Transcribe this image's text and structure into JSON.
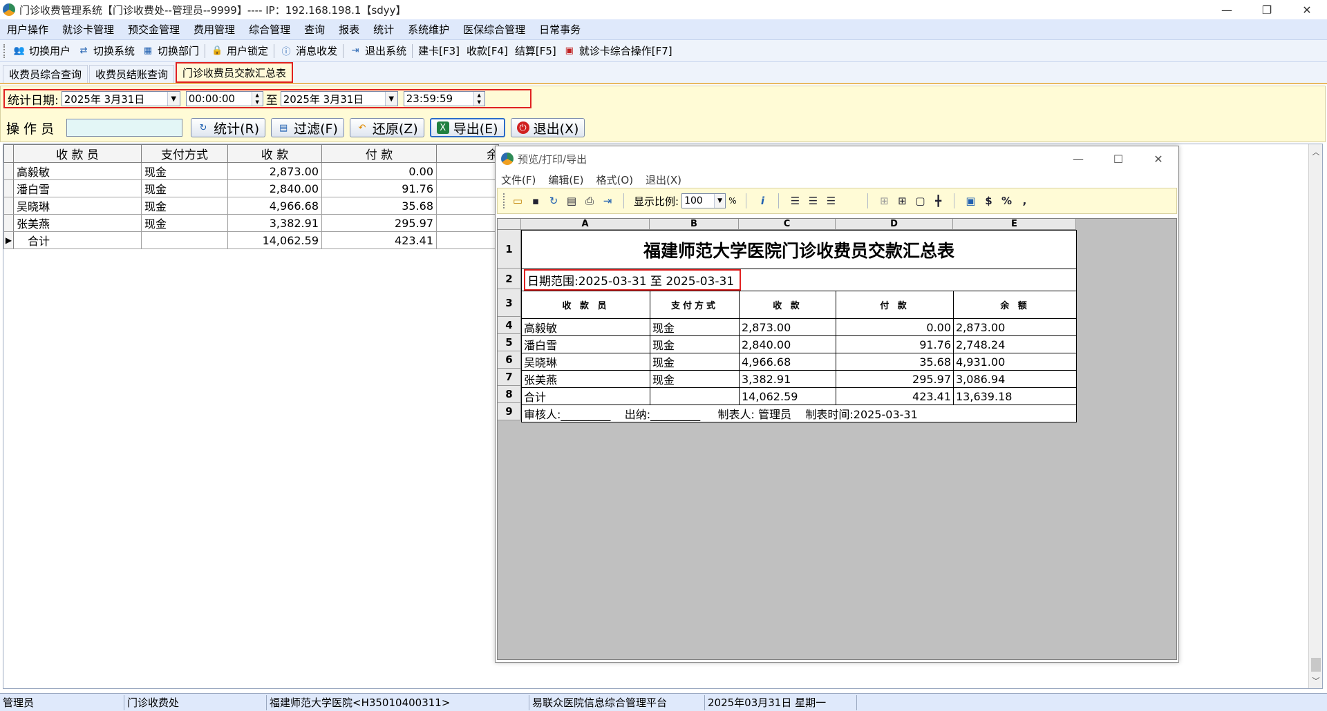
{
  "window": {
    "title": "门诊收费管理系统【门诊收费处--管理员--9999】---- IP：192.168.198.1【sdyy】",
    "controls": [
      "—",
      "❐",
      "✕"
    ]
  },
  "menu": [
    "用户操作",
    "就诊卡管理",
    "预交金管理",
    "费用管理",
    "综合管理",
    "查询",
    "报表",
    "统计",
    "系统维护",
    "医保综合管理",
    "日常事务"
  ],
  "toolbar": {
    "switch_user": "切换用户",
    "switch_system": "切换系统",
    "switch_dept": "切换部门",
    "user_lock": "用户锁定",
    "message": "消息收发",
    "exit_system": "退出系统",
    "build_card": "建卡[F3]",
    "collect": "收款[F4]",
    "settle": "结算[F5]",
    "card_ops": "就诊卡综合操作[F7]"
  },
  "tabs": [
    "收费员综合查询",
    "收费员结账查询",
    "门诊收费员交款汇总表"
  ],
  "filter": {
    "date_label": "统计日期:",
    "start_date": "2025年 3月31日",
    "start_time": "00:00:00",
    "to_label": "至",
    "end_date": "2025年 3月31日",
    "end_time": "23:59:59",
    "operator_label": "操 作 员",
    "operator_value": "",
    "btn_stat": "统计(R)",
    "btn_filter": "过滤(F)",
    "btn_restore": "还原(Z)",
    "btn_export": "导出(E)",
    "btn_exit": "退出(X)"
  },
  "grid": {
    "headers": [
      "收 款 员",
      "支付方式",
      "收  款",
      "付  款",
      "余"
    ],
    "rows": [
      {
        "name": "高毅敏",
        "pay": "现金",
        "recv": "2,873.00",
        "paid": "0.00"
      },
      {
        "name": "潘白雪",
        "pay": "现金",
        "recv": "2,840.00",
        "paid": "91.76"
      },
      {
        "name": "吴晓琳",
        "pay": "现金",
        "recv": "4,966.68",
        "paid": "35.68"
      },
      {
        "name": "张美燕",
        "pay": "现金",
        "recv": "3,382.91",
        "paid": "295.97"
      },
      {
        "name": "合计",
        "pay": "",
        "recv": "14,062.59",
        "paid": "423.41"
      }
    ],
    "current_row_marker": "▶"
  },
  "preview": {
    "title": "预览/打印/导出",
    "menu": [
      "文件(F)",
      "编辑(E)",
      "格式(O)",
      "退出(X)"
    ],
    "zoom_label": "显示比例:",
    "zoom_value": "100",
    "zoom_unit": "%",
    "col_letters": [
      "A",
      "B",
      "C",
      "D",
      "E"
    ],
    "row_numbers": [
      "1",
      "2",
      "3",
      "4",
      "5",
      "6",
      "7",
      "8",
      "9"
    ],
    "report_title": "福建师范大学医院门诊收费员交款汇总表",
    "date_range": "日期范围:2025-03-31    至  2025-03-31",
    "headers": [
      "收 款 员",
      "支付方式",
      "收  款",
      "付  款",
      "余  额"
    ],
    "rows": [
      {
        "name": "高毅敏",
        "pay": "现金",
        "recv": "2,873.00",
        "paid": "0.00",
        "bal": "2,873.00"
      },
      {
        "name": "潘白雪",
        "pay": "现金",
        "recv": "2,840.00",
        "paid": "91.76",
        "bal": "2,748.24"
      },
      {
        "name": "吴晓琳",
        "pay": "现金",
        "recv": "4,966.68",
        "paid": "35.68",
        "bal": "4,931.00"
      },
      {
        "name": "张美燕",
        "pay": "现金",
        "recv": "3,382.91",
        "paid": "295.97",
        "bal": "3,086.94"
      },
      {
        "name": "合计",
        "pay": "",
        "recv": "14,062.59",
        "paid": "423.41",
        "bal": "13,639.18"
      }
    ],
    "footer": "审核人:_________    出纳:_________     制表人: 管理员    制表时间:2025-03-31"
  },
  "status": [
    "管理员",
    "门诊收费处",
    "福建师范大学医院<H35010400311>",
    "易联众医院信息综合管理平台",
    "2025年03月31日 星期一",
    ""
  ]
}
